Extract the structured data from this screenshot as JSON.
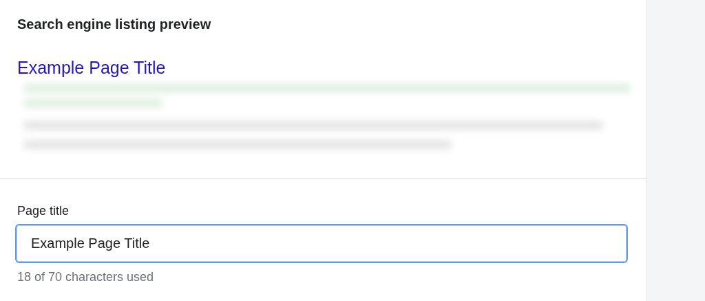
{
  "preview": {
    "heading": "Search engine listing preview",
    "title_link": "Example Page Title"
  },
  "page_title_field": {
    "label": "Page title",
    "value": "Example Page Title",
    "focused": true,
    "helper": "18 of 70 characters used"
  }
}
